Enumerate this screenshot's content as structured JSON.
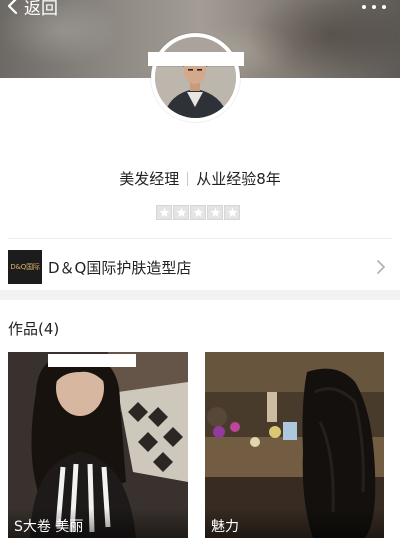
{
  "header": {
    "back_label": "返回",
    "back_icon": "chevron-left-icon",
    "more_icon": "more-dots-icon"
  },
  "profile": {
    "role": "美发经理",
    "experience": "从业经验8年",
    "rating": 0,
    "rating_max": 5
  },
  "shop": {
    "logo_text": "D&Q国际",
    "name": "D＆Q国际护肤造型店"
  },
  "works": {
    "title": "作品(4)",
    "items": [
      {
        "label": "S大卷 美丽"
      },
      {
        "label": "魅力"
      }
    ]
  },
  "colors": {
    "text_primary": "#222222",
    "star_empty": "#e4e4e4",
    "section_gap": "#f2f2f2"
  }
}
